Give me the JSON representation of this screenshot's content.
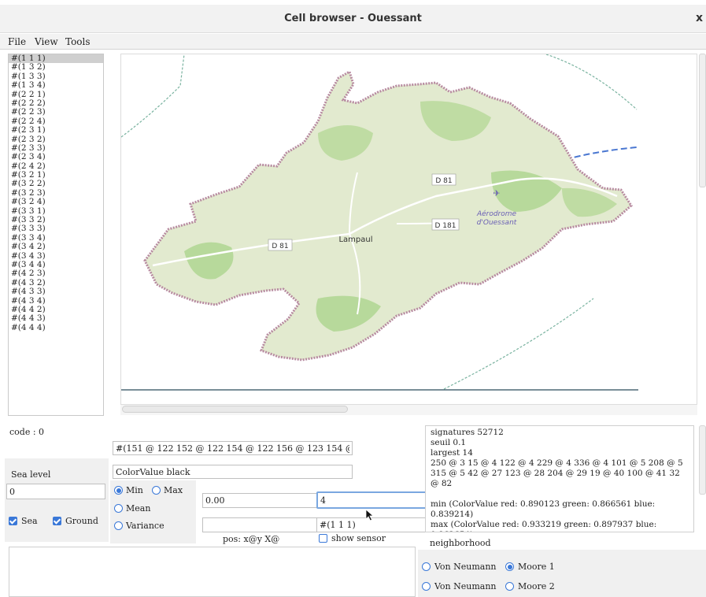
{
  "window": {
    "title": "Cell browser - Ouessant",
    "close_glyph": "x"
  },
  "menu": [
    "File",
    "View",
    "Tools"
  ],
  "cells": [
    "#(1 1 1)",
    "#(1 3 2)",
    "#(1 3 3)",
    "#(1 3 4)",
    "#(2 2 1)",
    "#(2 2 2)",
    "#(2 2 3)",
    "#(2 2 4)",
    "#(2 3 1)",
    "#(2 3 2)",
    "#(2 3 3)",
    "#(2 3 4)",
    "#(2 4 2)",
    "#(3 2 1)",
    "#(3 2 2)",
    "#(3 2 3)",
    "#(3 2 4)",
    "#(3 3 1)",
    "#(3 3 2)",
    "#(3 3 3)",
    "#(3 3 4)",
    "#(3 4 2)",
    "#(3 4 3)",
    "#(3 4 4)",
    "#(4 2 3)",
    "#(4 3 2)",
    "#(4 3 3)",
    "#(4 3 4)",
    "#(4 4 2)",
    "#(4 4 3)",
    "#(4 4 4)"
  ],
  "map": {
    "labels": {
      "d81_east": "D 81",
      "d181": "D 181",
      "d81_west": "D 81",
      "village": "Lampaul",
      "airport_line1": "Aérodrome",
      "airport_line2": "d'Ouessant"
    },
    "airport_glyph": "✈",
    "colors": {
      "land": "#dfe9cf",
      "green": "#b7d99b",
      "coast": "#b78aa0",
      "road": "#ffffff",
      "sea_route": "#4a77d1",
      "frame": "#2b4a5a"
    }
  },
  "controls": {
    "code_label": "code : 0",
    "points_field": "#(151 @ 122 152 @ 122 154 @ 122 156 @ 123 154 @ 12",
    "color_field": "ColorValue black",
    "sea_level_label": "Sea level",
    "sea_level_value": "0",
    "sea_label": "Sea",
    "ground_label": "Ground",
    "min_label": "Min",
    "max_label": "Max",
    "mean_label": "Mean",
    "variance_label": "Variance",
    "value_field_1": "0.00",
    "value_field_2": "4",
    "cell_field": "#(1 1 1)",
    "pos_label": "pos: x@y X@",
    "show_sensor_label": "show sensor"
  },
  "info": {
    "lines": [
      "signatures 52712",
      "seuil 0.1",
      "largest 14",
      "250 @ 3 15 @ 4 122 @ 4 229 @ 4 336 @ 4 101 @ 5 208 @ 5 315 @ 5 42 @ 27 123 @ 28 204 @ 29 19 @ 40 100 @ 41 32 @ 82",
      "",
      "min (ColorValue red: 0.890123 green: 0.866561 blue: 0.839214)",
      "max (ColorValue red: 0.933219 green: 0.897937 blue: 0.862654)"
    ]
  },
  "neighborhood": {
    "label": "neighborhood",
    "row1": {
      "von_neumann": "Von Neumann",
      "moore": "Moore 1"
    },
    "row2": {
      "von_neumann": "Von Neumann",
      "moore": "Moore 2"
    }
  }
}
